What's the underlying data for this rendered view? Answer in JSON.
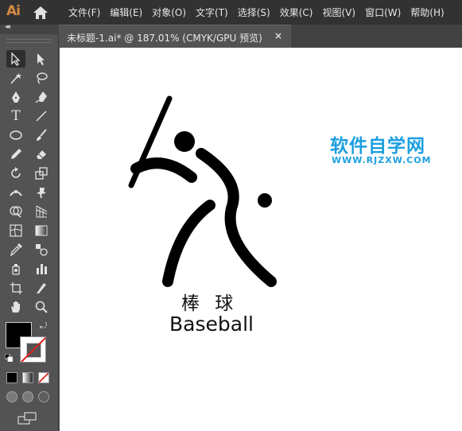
{
  "app": {
    "logo": "Ai"
  },
  "menu": [
    "文件(F)",
    "编辑(E)",
    "对象(O)",
    "文字(T)",
    "选择(S)",
    "效果(C)",
    "视图(V)",
    "窗口(W)",
    "帮助(H)"
  ],
  "tab": {
    "title": "未标题-1.ai* @ 187.01% (CMYK/GPU 预览)",
    "close": "×"
  },
  "tools": {
    "collapse": "◂◂",
    "type_tool": "T"
  },
  "colors": {
    "fill": "#000000",
    "stroke": "none",
    "accent": "#1d9fe0",
    "logo": "#d58a43"
  },
  "artwork": {
    "caption_cn": "棒 球",
    "caption_en": "Baseball"
  },
  "watermark": {
    "title": "软件自学网",
    "url": "WWW.RJZXW.COM"
  }
}
